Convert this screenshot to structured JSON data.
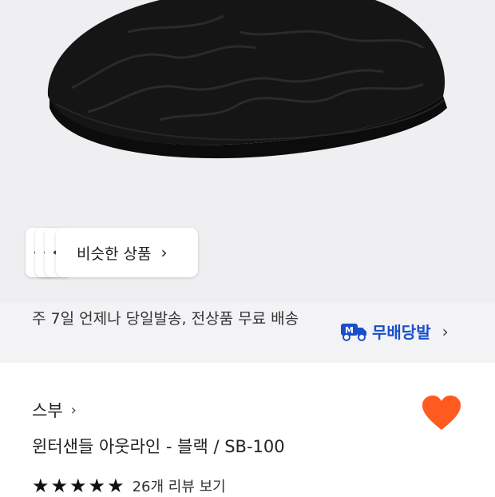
{
  "similar_products": {
    "label": "비슷한 상품"
  },
  "delivery": {
    "text": "주 7일 언제나 당일발송, 전상품 무료 배송",
    "free_shipping_label": "무배당발"
  },
  "product": {
    "brand": "스부",
    "name": "윈터샌들 아웃라인 - 블랙 / SB-100",
    "rating_stars": 5,
    "review_link": "26개 리뷰 보기"
  },
  "colors": {
    "heart": "#ff5a1f",
    "accent_blue": "#1a4fc9"
  }
}
